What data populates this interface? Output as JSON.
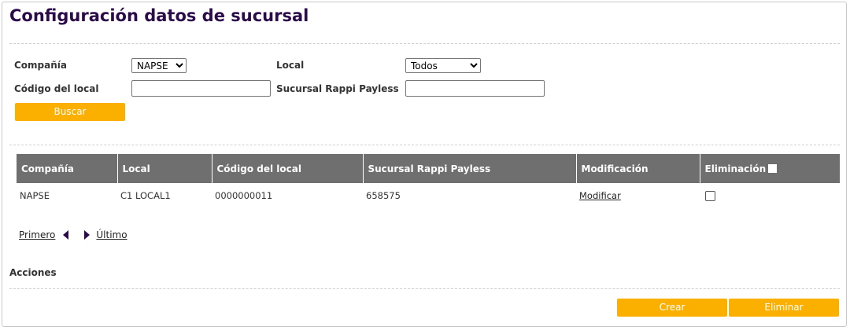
{
  "page": {
    "title": "Configuración datos de sucursal"
  },
  "filters": {
    "company_label": "Compañía",
    "company_value": "NAPSE",
    "local_label": "Local",
    "local_value": "Todos",
    "code_label": "Código del local",
    "code_value": "",
    "rappi_label": "Sucursal Rappi Payless",
    "rappi_value": "",
    "search_label": "Buscar"
  },
  "table": {
    "headers": [
      "Compañía",
      "Local",
      "Código del local",
      "Sucursal Rappi Payless",
      "Modificación",
      "Eliminación"
    ],
    "rows": [
      {
        "company": "NAPSE",
        "local": "C1 LOCAL1",
        "code": "0000000011",
        "rappi": "658575",
        "modify": "Modificar",
        "delete_checked": false
      }
    ]
  },
  "pager": {
    "first": "Primero",
    "last": "Último"
  },
  "actions": {
    "title": "Acciones",
    "create": "Crear",
    "delete": "Eliminar"
  },
  "colors": {
    "accent": "#fbb000",
    "title": "#2b0b4a",
    "header_bg": "#6f6f6f"
  }
}
